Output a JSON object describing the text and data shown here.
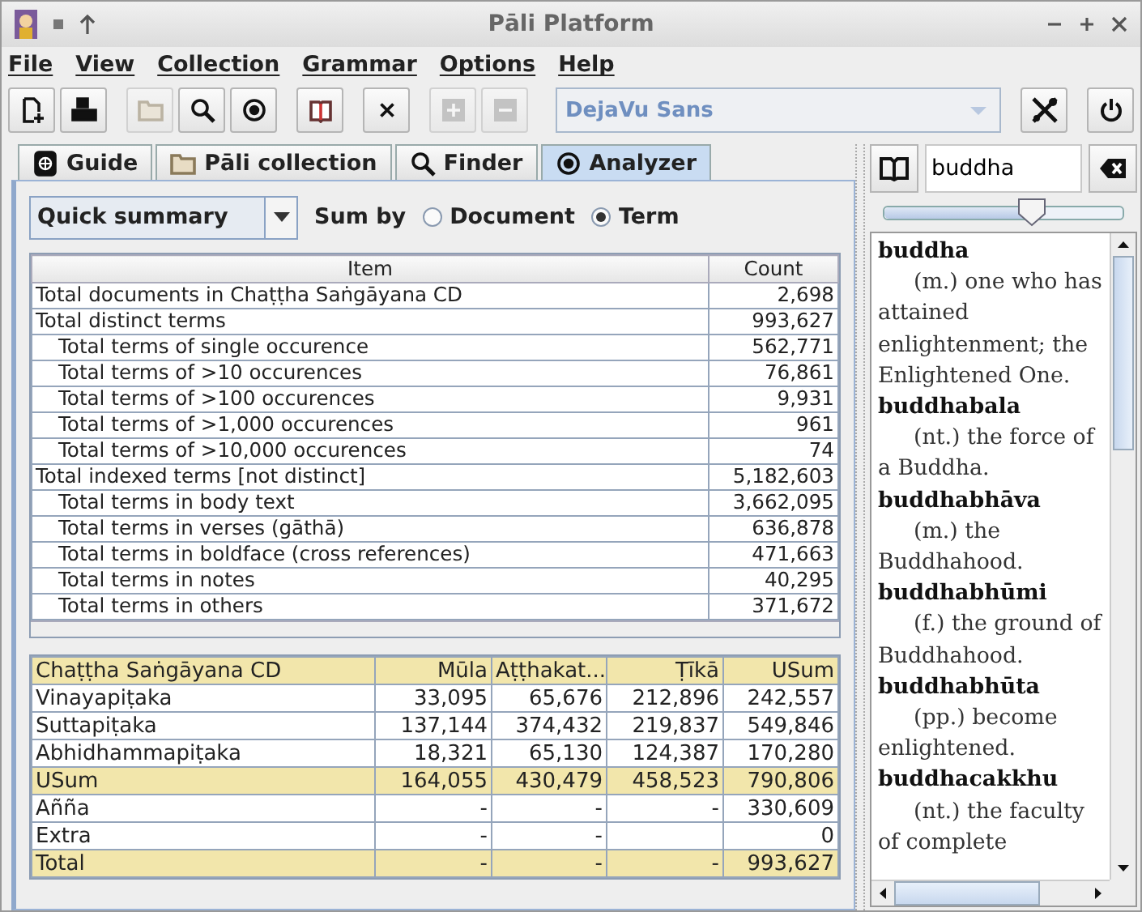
{
  "window": {
    "title": "Pāli Platform"
  },
  "menu": [
    "File",
    "View",
    "Collection",
    "Grammar",
    "Options",
    "Help"
  ],
  "toolbar": [
    {
      "kind": "new",
      "disabled": false
    },
    {
      "kind": "print",
      "disabled": false
    },
    {
      "kind": "folder",
      "disabled": true
    },
    {
      "kind": "search",
      "disabled": false
    },
    {
      "kind": "eye",
      "disabled": false
    },
    {
      "kind": "book",
      "disabled": false
    },
    {
      "kind": "close",
      "disabled": false
    },
    {
      "kind": "plus",
      "disabled": true
    },
    {
      "kind": "minus",
      "disabled": true
    }
  ],
  "font_select": {
    "value": "DejaVu Sans",
    "disabled": true
  },
  "tabs": [
    {
      "label": "Guide",
      "kind": "guide",
      "selected": false
    },
    {
      "label": "Pāli collection",
      "kind": "folder",
      "selected": false
    },
    {
      "label": "Finder",
      "kind": "search",
      "selected": false
    },
    {
      "label": "Analyzer",
      "kind": "eye",
      "selected": true
    }
  ],
  "summary_select": "Quick summary",
  "sum_by": {
    "label": "Sum by",
    "options": [
      {
        "label": "Document",
        "selected": false
      },
      {
        "label": "Term",
        "selected": true
      }
    ]
  },
  "summary_table": {
    "columns": [
      "Item",
      "Count"
    ],
    "rows": [
      {
        "item": "Total documents in Chaṭṭha Saṅgāyana CD",
        "count": "2,698"
      },
      {
        "item": "Total distinct terms",
        "count": "993,627",
        "children": [
          {
            "item": "Total terms of single occurence",
            "count": "562,771"
          },
          {
            "item": "Total terms of >10 occurences",
            "count": "76,861"
          },
          {
            "item": "Total terms of >100 occurences",
            "count": "9,931"
          },
          {
            "item": "Total terms of >1,000 occurences",
            "count": "961"
          },
          {
            "item": "Total terms of >10,000 occurences",
            "count": "74"
          }
        ]
      },
      {
        "item": "Total indexed terms [not distinct]",
        "count": "5,182,603",
        "children": [
          {
            "item": "Total terms in body text",
            "count": "3,662,095"
          },
          {
            "item": "Total terms in verses (gāthā)",
            "count": "636,878"
          },
          {
            "item": "Total terms in boldface (cross references)",
            "count": "471,663"
          },
          {
            "item": "Total terms in notes",
            "count": "40,295"
          },
          {
            "item": "Total terms in others",
            "count": "371,672"
          }
        ]
      }
    ]
  },
  "pitaka_table": {
    "columns": [
      "Chaṭṭha Saṅgāyana CD",
      "Mūla",
      "Aṭṭhakat...",
      "Ṭīkā",
      "USum"
    ],
    "rows": [
      {
        "kind": "plain",
        "cells": [
          "Vinayapiṭaka",
          "33,095",
          "65,676",
          "212,896",
          "242,557"
        ]
      },
      {
        "kind": "plain",
        "cells": [
          "Suttapiṭaka",
          "137,144",
          "374,432",
          "219,837",
          "549,846"
        ]
      },
      {
        "kind": "plain",
        "cells": [
          "Abhidhammapiṭaka",
          "18,321",
          "65,130",
          "124,387",
          "170,280"
        ]
      },
      {
        "kind": "sum",
        "cells": [
          "USum",
          "164,055",
          "430,479",
          "458,523",
          "790,806"
        ]
      },
      {
        "kind": "plain",
        "cells": [
          "Añña",
          "-",
          "-",
          "-",
          "330,609"
        ]
      },
      {
        "kind": "plain",
        "cells": [
          "Extra",
          "-",
          "-",
          null,
          "0"
        ]
      },
      {
        "kind": "sum",
        "cells": [
          "Total",
          "-",
          "-",
          "-",
          "993,627"
        ]
      }
    ]
  },
  "dictionary": {
    "query": "buddha",
    "zoom": {
      "level": 0.62
    },
    "entries": [
      {
        "term": "buddha",
        "definition": "(m.) one who has attained enlightenment; the Enlightened One."
      },
      {
        "term": "buddhabala",
        "definition": "(nt.) the force of a Buddha."
      },
      {
        "term": "buddhabhāva",
        "definition": "(m.) the Buddhahood."
      },
      {
        "term": "buddhabhūmi",
        "definition": "(f.) the ground of Buddhahood."
      },
      {
        "term": "buddhabhūta",
        "definition": "(pp.) become enlightened."
      },
      {
        "term": "buddhacakkhu",
        "definition": "(nt.) the faculty of complete"
      }
    ]
  }
}
